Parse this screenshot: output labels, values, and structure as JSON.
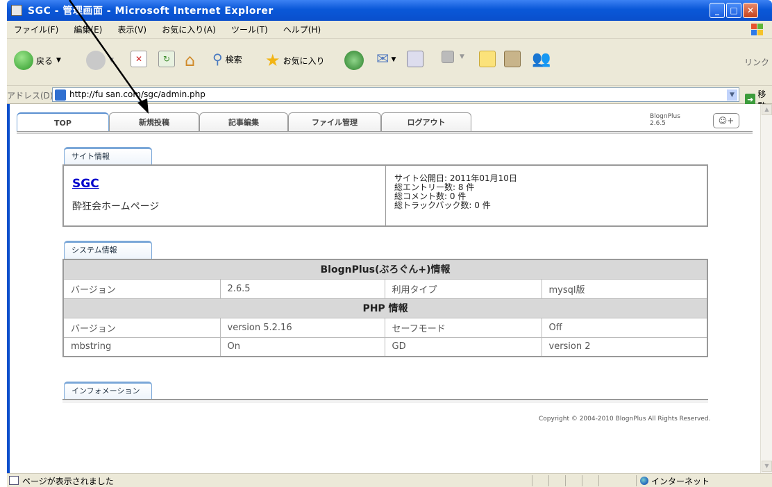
{
  "window": {
    "title": "SGC - 管理画面 - Microsoft Internet Explorer"
  },
  "menu": [
    "ファイル(F)",
    "編集(E)",
    "表示(V)",
    "お気に入り(A)",
    "ツール(T)",
    "ヘルプ(H)"
  ],
  "toolbar": {
    "back_label": "戻る",
    "search_label": "検索",
    "favorites_label": "お気に入り",
    "links_label": "リンク"
  },
  "address": {
    "label": "アドレス(D)",
    "url": "http://fu        san.com/sgc/admin.php",
    "go_label": "移動"
  },
  "tabs": [
    "TOP",
    "新規投稿",
    "記事編集",
    "ファイル管理",
    "ログアウト"
  ],
  "app_version": {
    "name": "BlognPlus",
    "version": "2.6.5"
  },
  "smiley_button": "☺+",
  "site_info": {
    "section_label": "サイト情報",
    "site_name": "SGC",
    "site_description": "酔狂会ホームページ",
    "stats": [
      "サイト公開日: 2011年01月10日",
      "総エントリー数: 8 件",
      "総コメント数: 0 件",
      "総トラックバック数: 0 件"
    ]
  },
  "system_info": {
    "section_label": "システム情報",
    "blogn_header": "BlognPlus(ぶろぐん+)情報",
    "blogn_row": [
      "バージョン",
      "2.6.5",
      "利用タイプ",
      "mysql版"
    ],
    "php_header": "PHP 情報",
    "php_rows": [
      [
        "バージョン",
        "version 5.2.16",
        "セーフモード",
        "Off"
      ],
      [
        "mbstring",
        "On",
        "GD",
        "version 2"
      ]
    ]
  },
  "information": {
    "section_label": "インフォメーション"
  },
  "copyright": "Copyright © 2004-2010 BlognPlus All Rights Reserved.",
  "status": {
    "text": "ページが表示されました",
    "zone": "インターネット"
  },
  "colors": {
    "titlebar": "#0a58d8",
    "chrome": "#ece9d8",
    "link": "#0000cc",
    "table_header": "#d8d8d8"
  }
}
